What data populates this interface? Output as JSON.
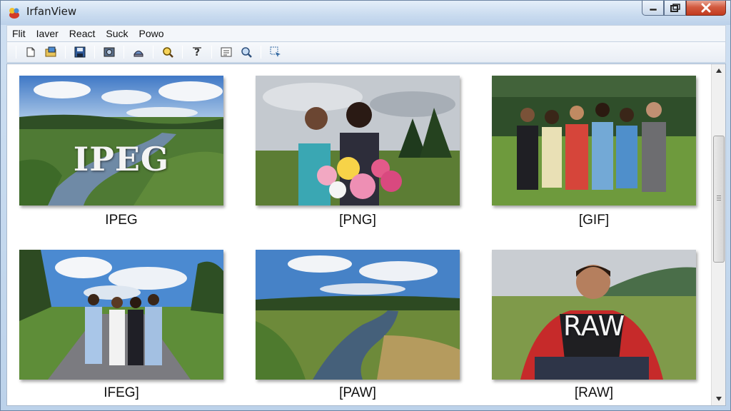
{
  "window": {
    "title": "IrfanView"
  },
  "menu": {
    "items": [
      "Flit",
      "Iaver",
      "React",
      "Suck",
      "Powo"
    ]
  },
  "toolbar": {
    "buttons": [
      "open-icon",
      "folder-icon",
      "save-icon",
      "film-icon",
      "print-icon",
      "zoom-icon",
      "help-icon",
      "info-icon",
      "search-icon",
      "select-icon"
    ]
  },
  "thumbnails": [
    {
      "caption": "IPEG",
      "overlay": "IPEG",
      "scene": "river-landscape"
    },
    {
      "caption": "[PNG]",
      "overlay": "",
      "scene": "girls-with-flowers"
    },
    {
      "caption": "[GIF]",
      "overlay": "",
      "scene": "group-photo"
    },
    {
      "caption": "IFEG]",
      "overlay": "",
      "scene": "people-on-road"
    },
    {
      "caption": "[PAW]",
      "overlay": "",
      "scene": "creek-landscape"
    },
    {
      "caption": "[RAW]",
      "overlay": "RAW",
      "scene": "man-in-field"
    }
  ],
  "colors": {
    "close_button": "#c23a1f",
    "title_bar": "#c9dbef",
    "accent": "#3a6ea5"
  }
}
